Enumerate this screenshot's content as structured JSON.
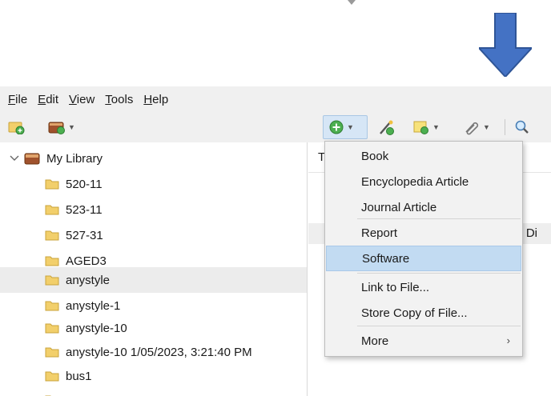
{
  "menubar": {
    "items": [
      {
        "accel": "F",
        "rest": "ile"
      },
      {
        "accel": "E",
        "rest": "dit"
      },
      {
        "accel": "V",
        "rest": "iew"
      },
      {
        "accel": "T",
        "rest": "ools"
      },
      {
        "accel": "H",
        "rest": "elp"
      }
    ]
  },
  "toolbar": {
    "icons": [
      "new-collection-icon",
      "new-library-icon",
      "new-item-icon",
      "add-by-identifier-icon",
      "new-note-icon",
      "add-attachment-icon",
      "search-icon"
    ]
  },
  "tree": {
    "library_label": "My Library",
    "items": [
      "520-11",
      "523-11",
      "527-31",
      "AGED3",
      "anystyle",
      "anystyle-1",
      "anystyle-10",
      "anystyle-10 1/05/2023, 3:21:40 PM",
      "bus1"
    ]
  },
  "items_pane": {
    "header_fragment": "T",
    "row_fragment": "nd Di"
  },
  "new_item_menu": {
    "items": [
      "Book",
      "Encyclopedia Article",
      "Journal Article",
      "Report",
      "Software",
      "Link to File...",
      "Store Copy of File...",
      "More"
    ],
    "highlighted": "Software",
    "submenu_arrow": "›"
  },
  "colors": {
    "arrow": "#4472c4",
    "menu_highlight": "#c2dbf2",
    "folder": "#f2cf6b"
  }
}
